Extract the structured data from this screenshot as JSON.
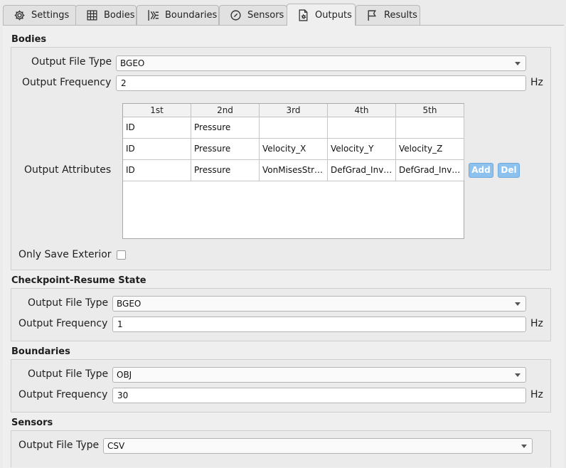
{
  "tabs": [
    {
      "label": "Settings",
      "icon": "gear-icon"
    },
    {
      "label": "Bodies",
      "icon": "bodies-icon"
    },
    {
      "label": "Boundaries",
      "icon": "boundaries-icon"
    },
    {
      "label": "Sensors",
      "icon": "sensor-gauge-icon"
    },
    {
      "label": "Outputs",
      "icon": "output-file-icon",
      "active": true
    },
    {
      "label": "Results",
      "icon": "flag-icon"
    }
  ],
  "bodies": {
    "title": "Bodies",
    "file_type_label": "Output File Type",
    "file_type_value": "BGEO",
    "frequency_label": "Output Frequency",
    "frequency_value": "2",
    "frequency_unit": "Hz",
    "attributes_label": "Output Attributes",
    "table": {
      "headers": [
        "1st",
        "2nd",
        "3rd",
        "4th",
        "5th"
      ],
      "rows": [
        [
          "ID",
          "Pressure",
          "",
          "",
          ""
        ],
        [
          "ID",
          "Pressure",
          "Velocity_X",
          "Velocity_Y",
          "Velocity_Z"
        ],
        [
          "ID",
          "Pressure",
          "VonMisesStr…",
          "DefGrad_Inv…",
          "DefGrad_Inv…"
        ]
      ]
    },
    "add_label": "Add",
    "del_label": "Del",
    "exterior_label": "Only Save Exterior"
  },
  "checkpoint": {
    "title": "Checkpoint-Resume State",
    "file_type_label": "Output File Type",
    "file_type_value": "BGEO",
    "frequency_label": "Output Frequency",
    "frequency_value": "1",
    "frequency_unit": "Hz"
  },
  "boundaries": {
    "title": "Boundaries",
    "file_type_label": "Output File Type",
    "file_type_value": "OBJ",
    "frequency_label": "Output Frequency",
    "frequency_value": "30",
    "frequency_unit": "Hz"
  },
  "sensors": {
    "title": "Sensors",
    "file_type_label": "Output File Type",
    "file_type_value": "CSV"
  },
  "colors": {
    "accent_button": "#8ec2ee",
    "panel_bg": "#ebebeb"
  }
}
